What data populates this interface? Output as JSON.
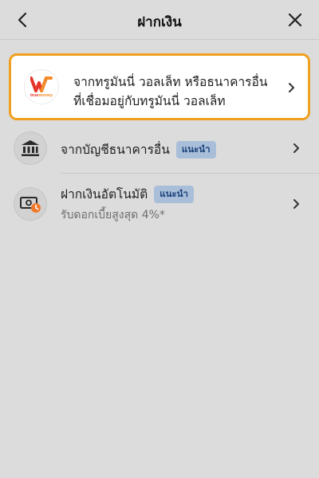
{
  "header": {
    "title": "ฝากเงิน"
  },
  "highlight": {
    "line1": "จากทรูมันนี่ วอลเล็ท หรือธนาคารอื่น",
    "line2": "ที่เชื่อมอยู่กับทรูมันนี่ วอลเล็ท",
    "logo_word_true": "true",
    "logo_word_money": "money",
    "border_color": "#f0a020"
  },
  "options": [
    {
      "label": "จากบัญชีธนาคารอื่น",
      "badge": "แนะนำ",
      "icon": "bank-icon"
    },
    {
      "label": "ฝากเงินอัตโนมัติ",
      "badge": "แนะนำ",
      "subtitle": "รับดอกเบี้ยสูงสุด 4%*",
      "icon": "auto-deposit-icon"
    }
  ],
  "colors": {
    "badge_bg": "#a9bfd9",
    "badge_text": "#1a3f7a",
    "brand_red": "#e8332a",
    "brand_orange": "#f28c28"
  }
}
